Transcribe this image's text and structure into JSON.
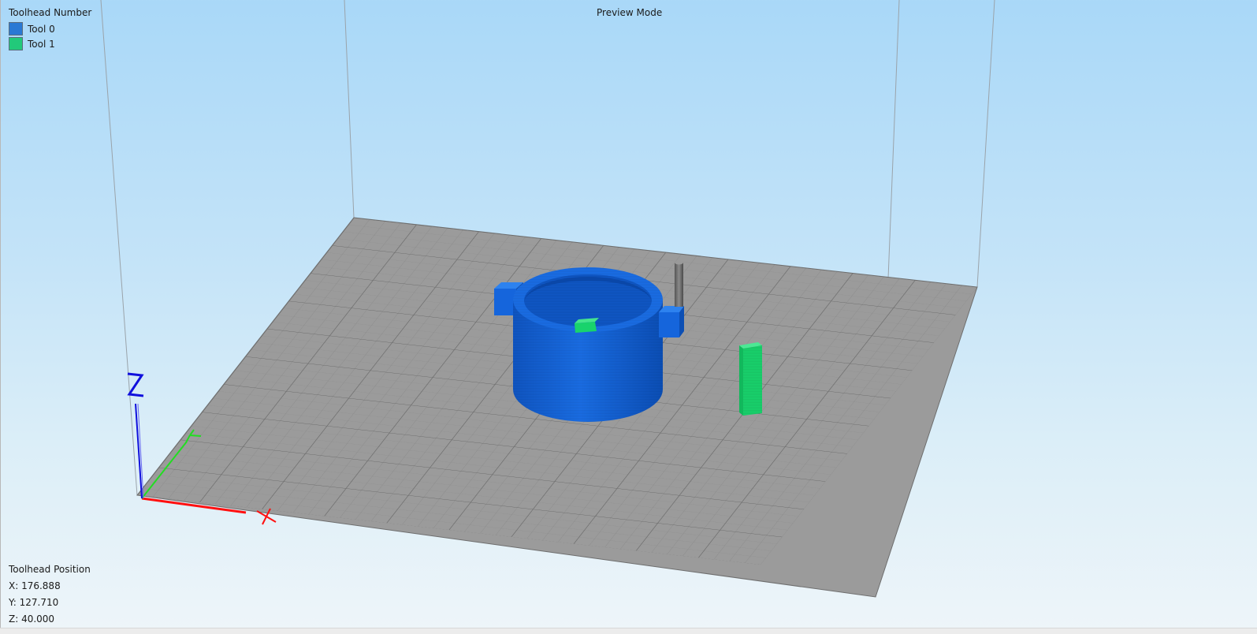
{
  "legend": {
    "title": "Toolhead Number",
    "items": [
      {
        "label": "Tool 0",
        "color": "#2a79d4"
      },
      {
        "label": "Tool 1",
        "color": "#22c97a"
      }
    ]
  },
  "mode_label": "Preview Mode",
  "toolhead_position": {
    "title": "Toolhead Position",
    "x": "X: 176.888",
    "y": "Y: 127.710",
    "z": "Z: 40.000"
  },
  "colors": {
    "tool0": "#1463d8",
    "tool1": "#19d36c",
    "bed": "#9b9b9b",
    "axis_x": "#ff1010",
    "axis_y": "#22dd22",
    "axis_z": "#1010dd"
  },
  "icons": [
    "x-axis-icon",
    "y-axis-icon",
    "z-axis-icon",
    "nozzle-icon"
  ]
}
